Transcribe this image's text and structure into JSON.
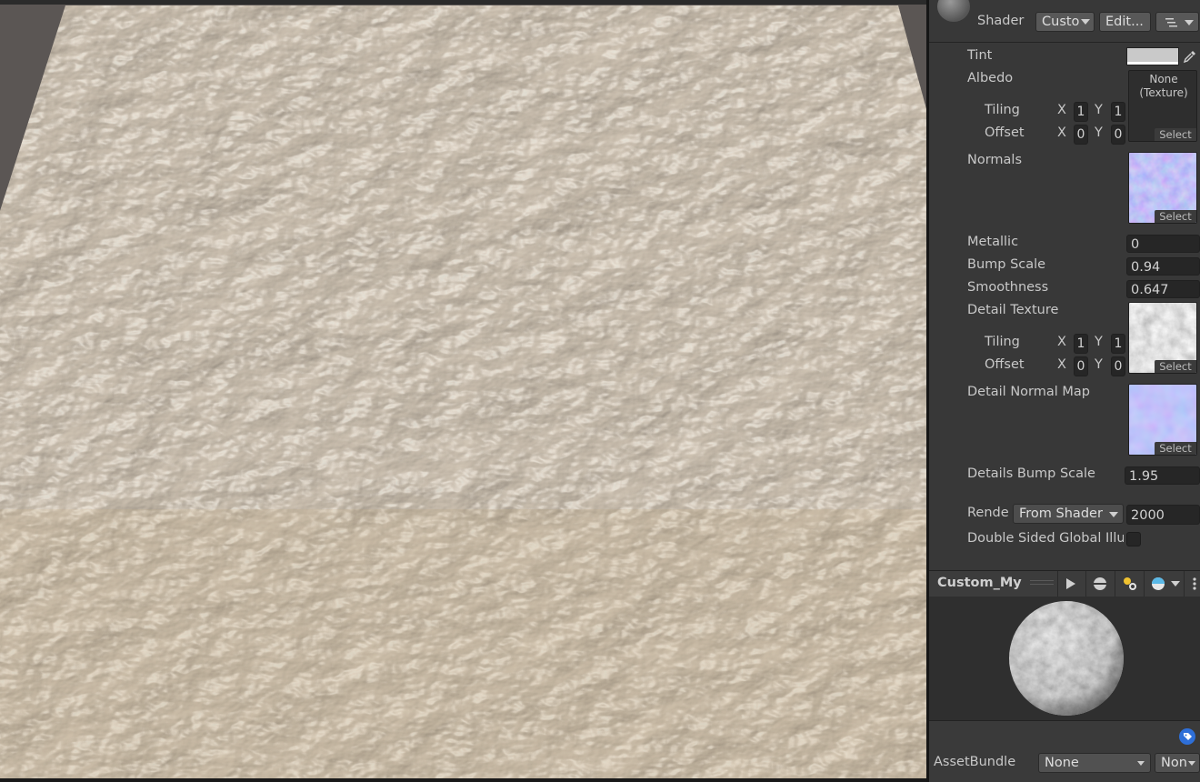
{
  "header": {
    "shader_label": "Shader",
    "shader_value": "Custo",
    "edit_button": "Edit..."
  },
  "properties": {
    "tint": {
      "label": "Tint",
      "color": "#c9c9c9"
    },
    "albedo": {
      "label": "Albedo",
      "texture_text": "None\n(Texture)",
      "select_label": "Select",
      "tiling_label": "Tiling",
      "tiling_x": "1",
      "tiling_y": "1",
      "offset_label": "Offset",
      "offset_x": "0",
      "offset_y": "0",
      "x_label": "X",
      "y_label": "Y"
    },
    "normals": {
      "label": "Normals",
      "select_label": "Select"
    },
    "metallic": {
      "label": "Metallic",
      "value": "0"
    },
    "bump_scale": {
      "label": "Bump Scale",
      "value": "0.94"
    },
    "smoothness": {
      "label": "Smoothness",
      "value": "0.647"
    },
    "detail_texture": {
      "label": "Detail Texture",
      "select_label": "Select",
      "tiling_label": "Tiling",
      "tiling_x": "1",
      "tiling_y": "1",
      "offset_label": "Offset",
      "offset_x": "0",
      "offset_y": "0",
      "x_label": "X",
      "y_label": "Y"
    },
    "detail_normal_map": {
      "label": "Detail Normal Map",
      "select_label": "Select"
    },
    "details_bump_scale": {
      "label": "Details Bump Scale",
      "value": "1.95"
    },
    "render_queue": {
      "label": "Rende",
      "mode": "From Shader",
      "value": "2000"
    },
    "double_sided_gi": {
      "label": "Double Sided Global Illu",
      "checked": false
    }
  },
  "preview": {
    "title": "Custom_My F",
    "icons": [
      "play-icon",
      "sphere-mesh-icon",
      "lights-icon",
      "preview-sky-icon",
      "more-icon"
    ]
  },
  "footer": {
    "asset_bundle_label": "AssetBundle",
    "asset_bundle_value": "None",
    "variant_value": "Non"
  },
  "colors": {
    "panel_bg": "#383838",
    "field_bg": "#262626",
    "normal_map_blue": "#7d7ff2",
    "terrain_base": "#cfc4b4"
  }
}
